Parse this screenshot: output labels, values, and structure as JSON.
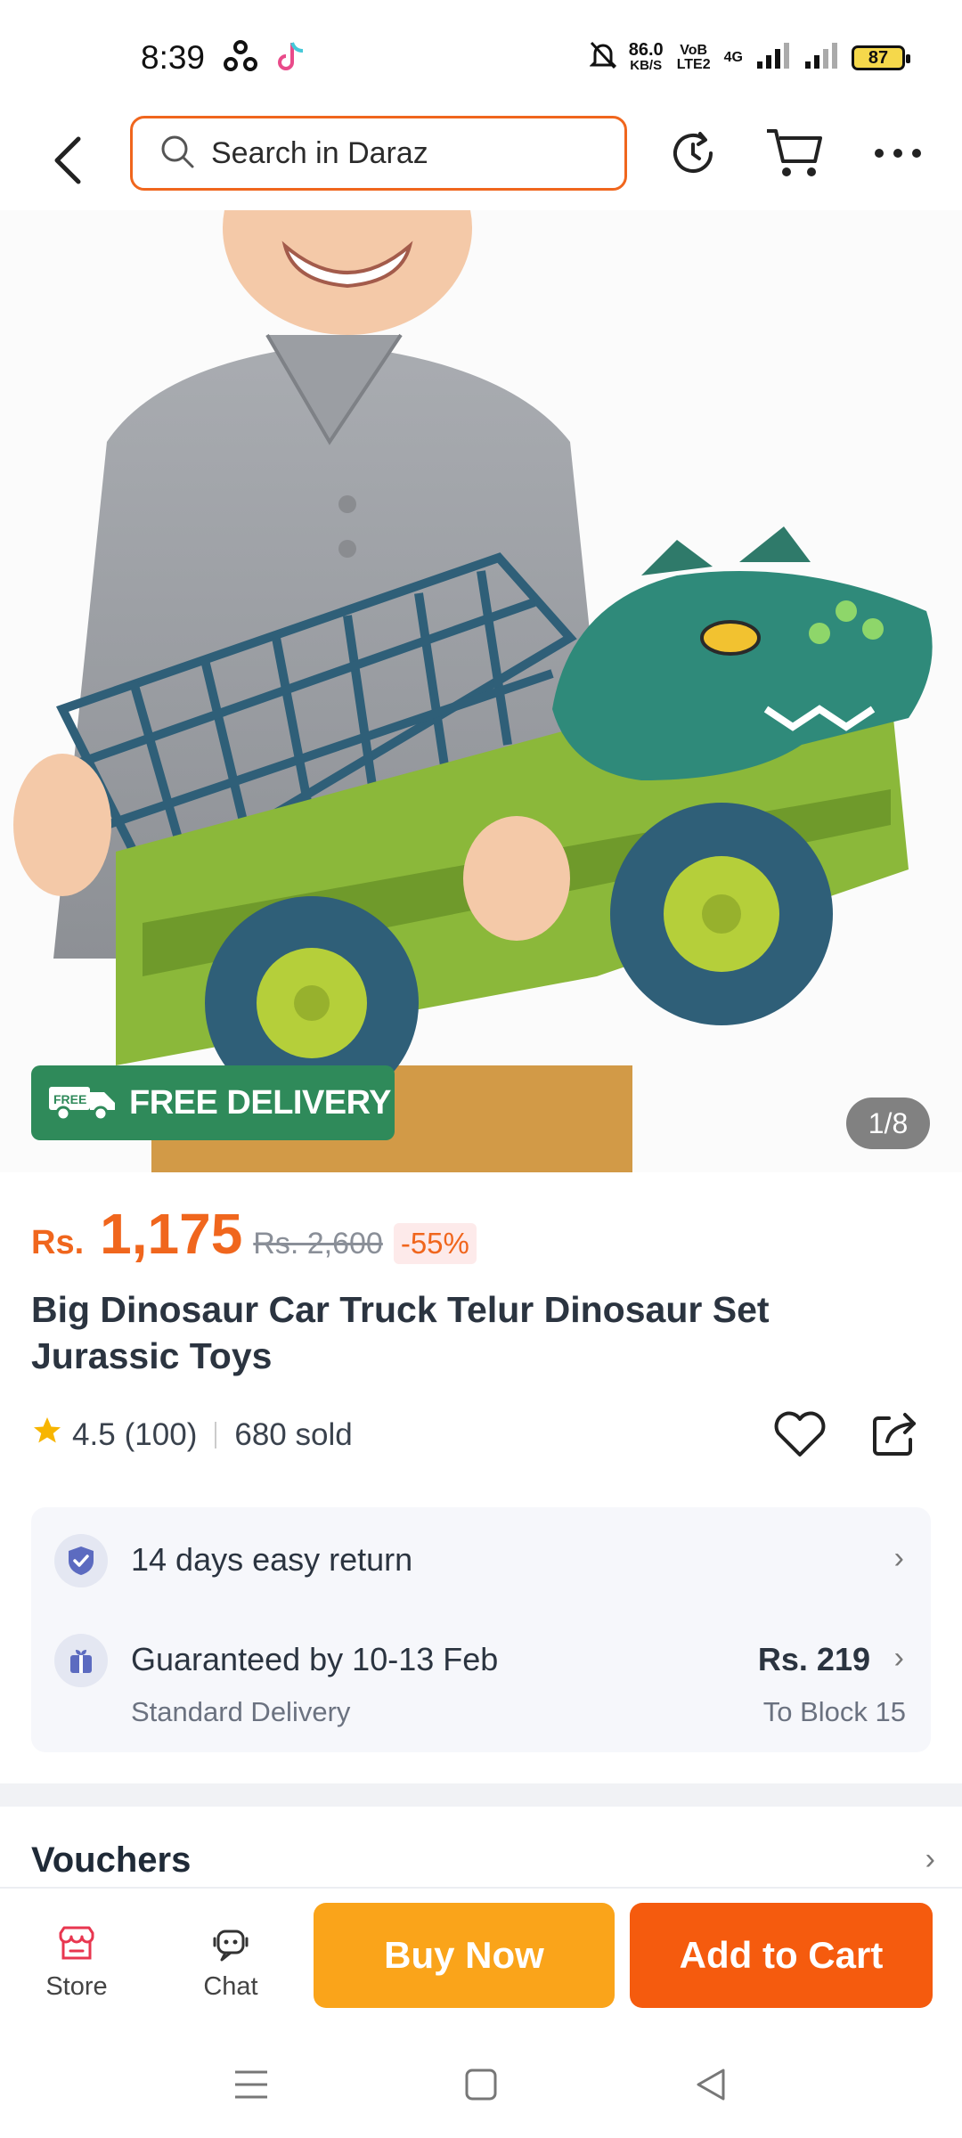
{
  "status_bar": {
    "time": "8:39",
    "net_speed_value": "86.0",
    "net_speed_unit": "KB/S",
    "volte_label": "VoB LTE2",
    "network_label": "4G",
    "battery": "87"
  },
  "search": {
    "placeholder": "Search in Daraz"
  },
  "product": {
    "free_delivery_badge": "FREE DELIVERY",
    "free_delivery_tag": "FREE",
    "image_counter": "1/8",
    "currency": "Rs.",
    "price": "1,175",
    "original_price": "Rs. 2,600",
    "discount": "-55%",
    "title": "Big Dinosaur Car Truck Telur Dinosaur Set Jurassic Toys",
    "rating": "4.5",
    "rating_count": "(100)",
    "sold": "680 sold"
  },
  "info": {
    "return_text": "14 days easy return",
    "delivery_title": "Guaranteed by 10-13 Feb",
    "delivery_type": "Standard Delivery",
    "delivery_price": "Rs. 219",
    "delivery_location": "To Block 15"
  },
  "vouchers": {
    "title": "Vouchers"
  },
  "bottom_bar": {
    "store_label": "Store",
    "chat_label": "Chat",
    "buy_now_label": "Buy Now",
    "add_to_cart_label": "Add to Cart"
  },
  "colors": {
    "accent": "#f0661d",
    "buy_now": "#faa41a",
    "add_to_cart": "#f55b0e",
    "free_delivery": "#2f8a5a"
  }
}
